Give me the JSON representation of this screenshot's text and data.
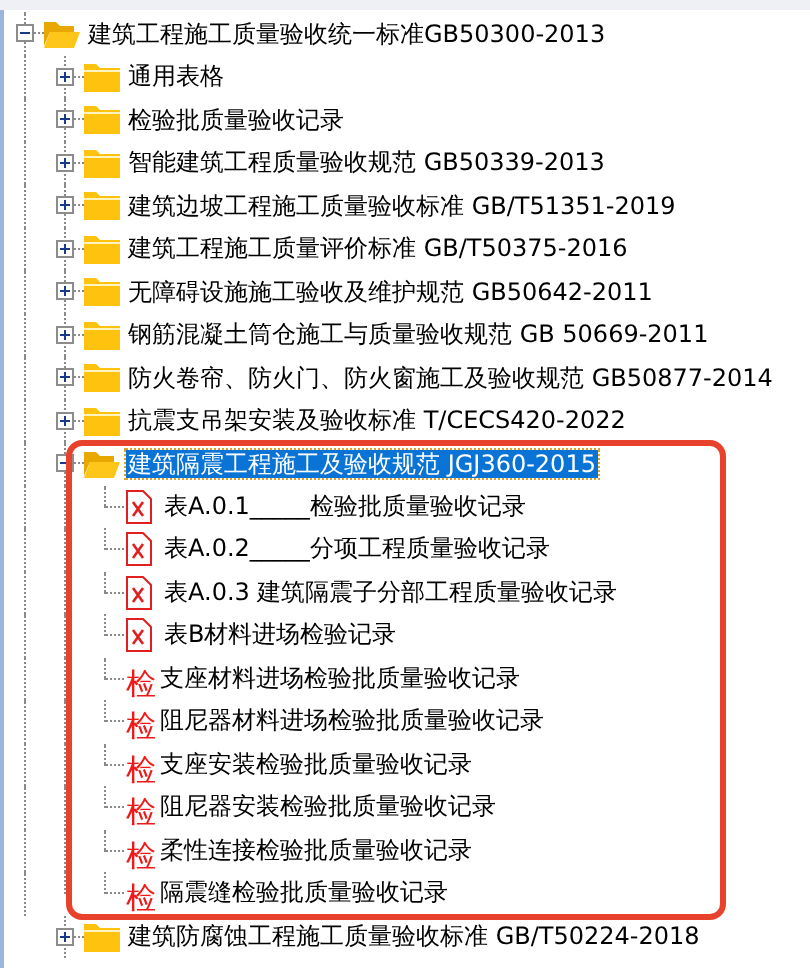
{
  "tree": {
    "label": "建筑工程施工质量验收统一标准GB50300-2013",
    "expanded": true,
    "selected": false,
    "children": [
      {
        "label": "通用表格",
        "expanded": false,
        "selected": false
      },
      {
        "label": "检验批质量验收记录",
        "expanded": false,
        "selected": false
      },
      {
        "label": "智能建筑工程质量验收规范 GB50339-2013",
        "expanded": false,
        "selected": false
      },
      {
        "label": "建筑边坡工程施工质量验收标准 GB/T51351-2019",
        "expanded": false,
        "selected": false
      },
      {
        "label": "建筑工程施工质量评价标准 GB/T50375-2016",
        "expanded": false,
        "selected": false
      },
      {
        "label": "无障碍设施施工验收及维护规范 GB50642-2011",
        "expanded": false,
        "selected": false
      },
      {
        "label": "钢筋混凝土筒仓施工与质量验收规范 GB 50669-2011",
        "expanded": false,
        "selected": false
      },
      {
        "label": "防火卷帘、防火门、防火窗施工及验收规范 GB50877-2014",
        "expanded": false,
        "selected": false
      },
      {
        "label": "抗震支吊架安装及验收标准 T/CECS420-2022",
        "expanded": false,
        "selected": false
      },
      {
        "label": "建筑隔震工程施工及验收规范 JGJ360-2015",
        "expanded": true,
        "selected": true,
        "highlighted": true,
        "children": [
          {
            "kind": "form",
            "label": "表A.0.1_____检验批质量验收记录"
          },
          {
            "kind": "form",
            "label": "表A.0.2_____分项工程质量验收记录"
          },
          {
            "kind": "form",
            "label": "表A.0.3 建筑隔震子分部工程质量验收记录"
          },
          {
            "kind": "form",
            "label": "表B材料进场检验记录"
          },
          {
            "kind": "inspection",
            "badge": "检",
            "label": "支座材料进场检验批质量验收记录"
          },
          {
            "kind": "inspection",
            "badge": "检",
            "label": "阻尼器材料进场检验批质量验收记录"
          },
          {
            "kind": "inspection",
            "badge": "检",
            "label": "支座安装检验批质量验收记录"
          },
          {
            "kind": "inspection",
            "badge": "检",
            "label": "阻尼器安装检验批质量验收记录"
          },
          {
            "kind": "inspection",
            "badge": "检",
            "label": "柔性连接检验批质量验收记录"
          },
          {
            "kind": "inspection",
            "badge": "检",
            "label": "隔震缝检验批质量验收记录"
          }
        ]
      },
      {
        "label": "建筑防腐蚀工程施工质量验收标准 GB/T50224-2018",
        "expanded": false,
        "selected": false
      }
    ]
  }
}
